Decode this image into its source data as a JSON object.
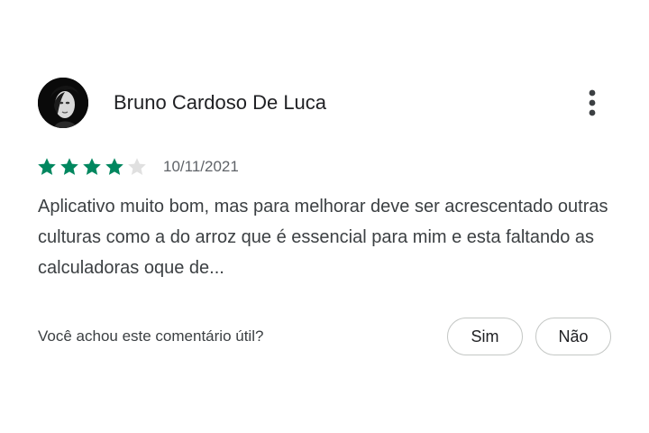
{
  "review": {
    "author": "Bruno Cardoso De Luca",
    "avatar_icon": "avatar-photo-icon",
    "menu_icon": "more-vert-icon",
    "rating": 4,
    "rating_max": 5,
    "star_color_filled": "#01875f",
    "star_color_empty": "#e0e0e0",
    "date": "10/11/2021",
    "text": "Aplicativo muito bom, mas para melhorar deve ser acrescentado outras culturas como a do arroz que é essencial para mim e esta faltando as calculadoras oque de..."
  },
  "helpful": {
    "question": "Você achou este comentário útil?",
    "yes_label": "Sim",
    "no_label": "Não"
  }
}
